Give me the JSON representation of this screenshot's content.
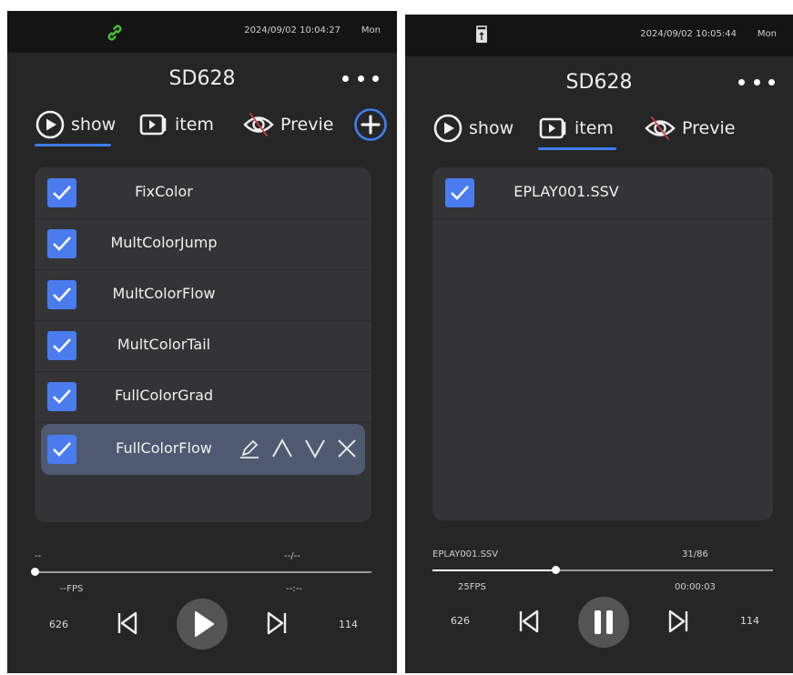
{
  "screens": [
    {
      "status": {
        "time": "2024/09/02 10:04:27",
        "day": "Mon",
        "icon": "link-icon",
        "icon_color": "#4cbc3c"
      },
      "title": "SD628",
      "tabs": [
        {
          "label": "show",
          "icon": "play-circle-icon",
          "active": true
        },
        {
          "label": "item",
          "icon": "video-file-icon",
          "active": false
        },
        {
          "label": "Previe",
          "icon": "eye-off-icon",
          "active": false
        }
      ],
      "list": [
        {
          "label": "FixColor",
          "checked": true
        },
        {
          "label": "MultColorJump",
          "checked": true
        },
        {
          "label": "MultColorFlow",
          "checked": true
        },
        {
          "label": "MultColorTail",
          "checked": true
        },
        {
          "label": "FullColorGrad",
          "checked": true
        },
        {
          "label": "FullColorFlow",
          "checked": true,
          "selected": true
        }
      ],
      "player": {
        "file": "--",
        "counter": "--/--",
        "fps": "--FPS",
        "elapsed": "--:--",
        "progress": 0.0,
        "left_value": "626",
        "right_value": "114",
        "state": "paused"
      }
    },
    {
      "status": {
        "time": "2024/09/02 10:05:44",
        "day": "Mon",
        "icon": "usb-drive-icon"
      },
      "title": "SD628",
      "tabs": [
        {
          "label": "show",
          "icon": "play-circle-icon",
          "active": false
        },
        {
          "label": "item",
          "icon": "video-file-icon",
          "active": true
        },
        {
          "label": "Previe",
          "icon": "eye-off-icon",
          "active": false
        }
      ],
      "list": [
        {
          "label": "EPLAY001.SSV",
          "checked": true
        }
      ],
      "player": {
        "file": "EPLAY001.SSV",
        "counter": "31/86",
        "fps": "25FPS",
        "elapsed": "00:00:03",
        "progress": 0.36,
        "left_value": "626",
        "right_value": "114",
        "state": "playing"
      }
    }
  ],
  "colors": {
    "accent": "#3f7df0",
    "checkbox": "#4a7cf0",
    "selected_row": "#4f5a72",
    "panel": "#343436",
    "background": "#262626"
  }
}
